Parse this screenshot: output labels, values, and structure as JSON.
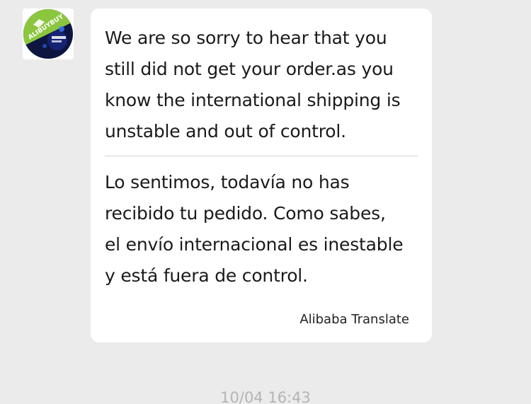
{
  "chat": {
    "avatar_icon": "alibuybuy-logo-icon",
    "avatar_logo_text": "ALIBUYBUY",
    "message": {
      "original": "We are so sorry to hear that you\nstill did not get your order.as you\nknow the international shipping is\nunstable and out of control.",
      "translated": "Lo sentimos, todavía no has\nrecibido tu pedido. Como sabes,\nel envío internacional es inestable\ny está fuera de control.",
      "translation_source": "Alibaba Translate"
    },
    "timestamp": "10/04 16:43"
  },
  "colors": {
    "background": "#ebebeb",
    "bubble": "#ffffff",
    "text": "#1a1a1a",
    "timestamp": "#b5b5b5",
    "logo_green": "#8cc63f",
    "logo_navy": "#0d1540"
  }
}
